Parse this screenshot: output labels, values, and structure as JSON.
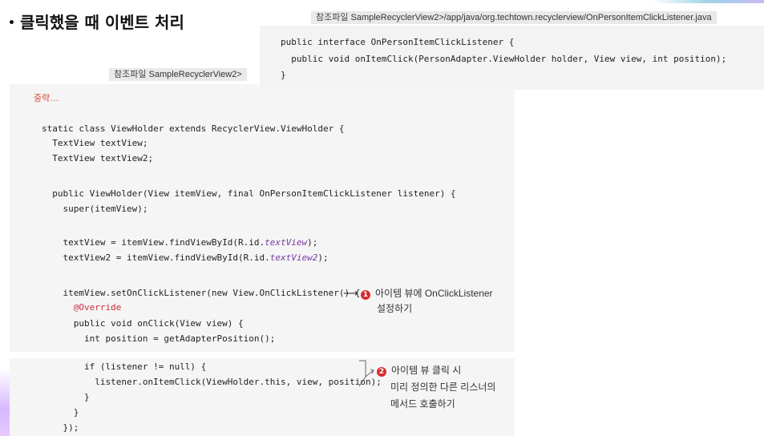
{
  "title": {
    "bullet": "•",
    "text": "클릭했을 때 이벤트 처리"
  },
  "top_file": {
    "prefix": "참조파일",
    "path": "SampleRecyclerView2>/app/java/org.techtown.recyclerview/OnPersonItemClickListener.java"
  },
  "top_code": [
    "public interface OnPersonItemClickListener {",
    "  public void onItemClick(PersonAdapter.ViewHolder holder, View view, int position);",
    "}"
  ],
  "back_file": {
    "prefix": "참조파일",
    "path": "SampleRecyclerView2>"
  },
  "omission": "중략…",
  "code": {
    "l1": "static class ViewHolder extends RecyclerView.ViewHolder {",
    "l2": "  TextView textView;",
    "l3": "  TextView textView2;",
    "l4": "  public ViewHolder(View itemView, final OnPersonItemClickListener listener) {",
    "l5": "    super(itemView);",
    "l6a": "    textView = itemView.findViewById(R.id.",
    "l6b": "textView",
    "l6c": ");",
    "l7a": "    textView2 = itemView.findViewById(R.id.",
    "l7b": "textView2",
    "l7c": ");",
    "l8": "    itemView.setOnClickListener(new View.OnClickListener() {",
    "l9": "      @Override",
    "l10": "      public void onClick(View view) {",
    "l11": "        int position = getAdapterPosition();",
    "l12": "        if (listener != null) {",
    "l13": "          listener.onItemClick(ViewHolder.this, view, position);",
    "l14": "        }",
    "l15": "      }",
    "l16": "    });"
  },
  "callout1": {
    "num": "1",
    "line1": "아이템 뷰에 OnClickListener",
    "line2": "설정하기"
  },
  "callout2": {
    "num": "2",
    "line1": "아이템 뷰 클릭 시",
    "line2": "미리 정의한 다른 리스너의",
    "line3": "메서드 호출하기"
  },
  "colors": {
    "accent_red": "#d82b33",
    "code_bg": "#f5f5f5",
    "label_bg": "#e9e9e9"
  }
}
